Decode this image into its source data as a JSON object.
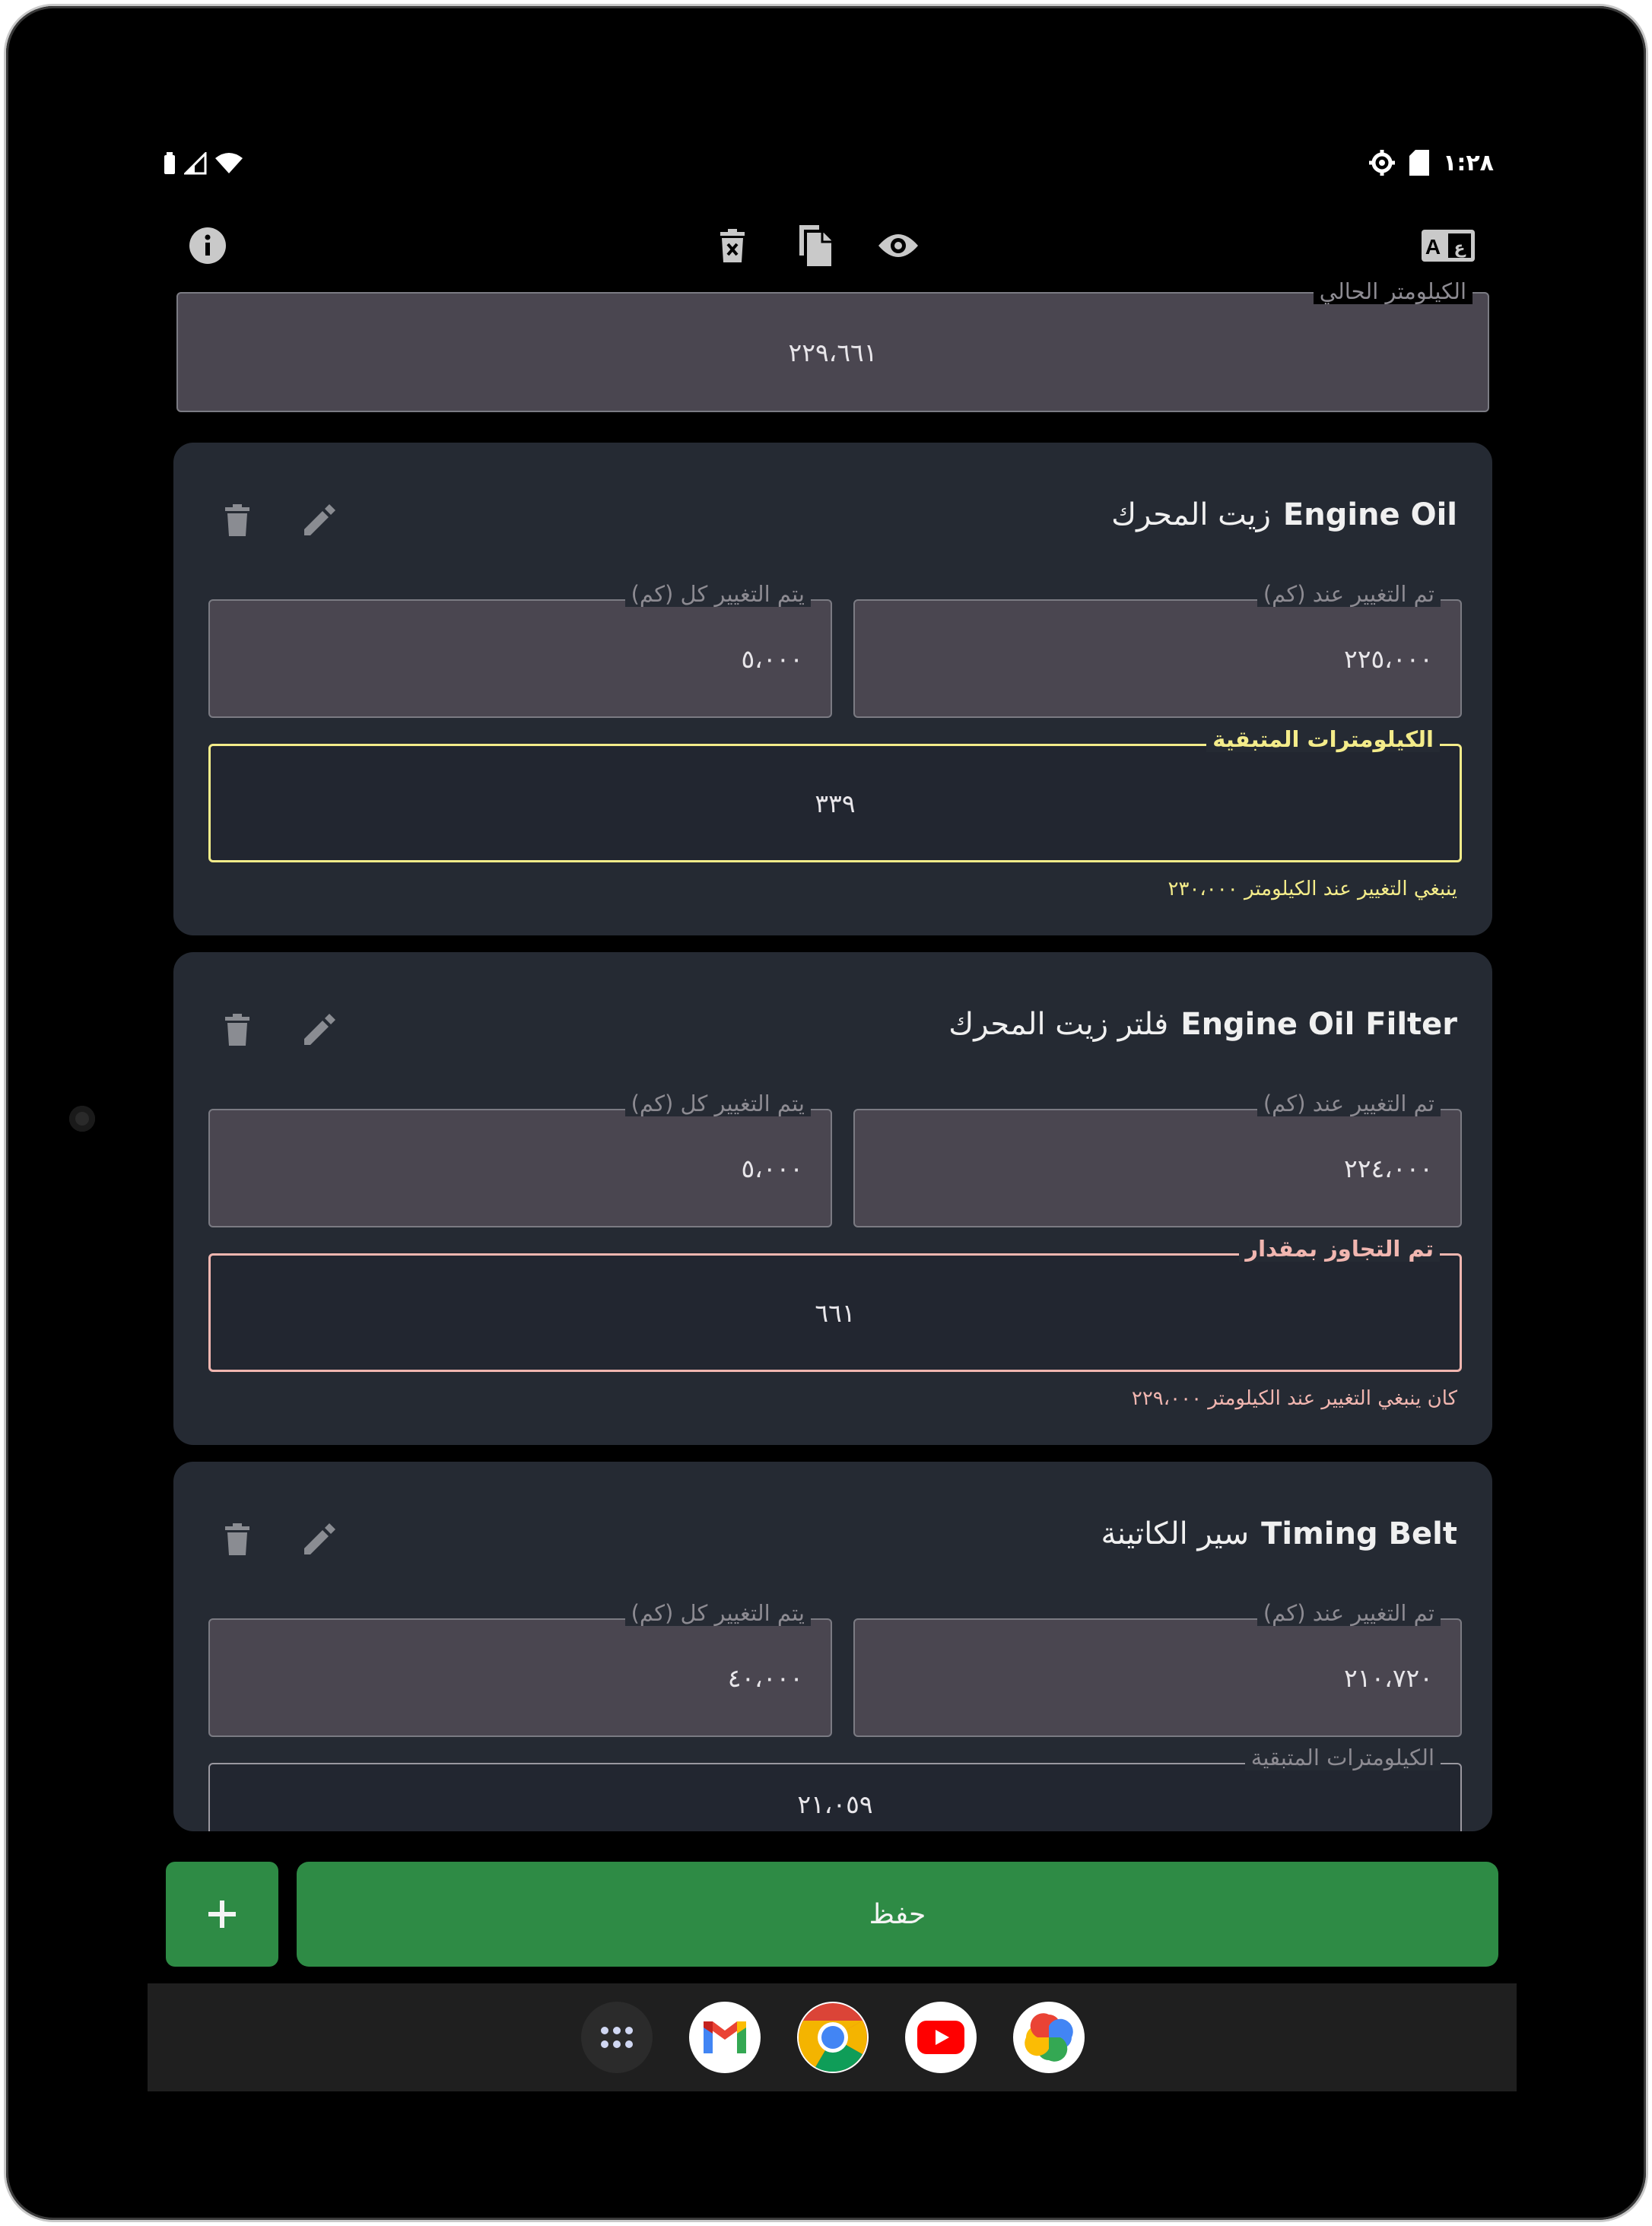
{
  "status_bar": {
    "time": "١:٢٨",
    "icons": [
      "settings-gear-icon",
      "sd-card-icon",
      "wifi-icon",
      "signal-icon",
      "battery-icon"
    ]
  },
  "toolbar": {
    "icons": [
      "info-icon",
      "delete-all-icon",
      "copy-icon",
      "visibility-icon",
      "translate-icon"
    ]
  },
  "current_km": {
    "label": "الكيلومتر الحالي",
    "value": "٢٢٩،٦٦١"
  },
  "cards": [
    {
      "title_en": "Engine Oil",
      "title_ar": "زيت المحرك",
      "changed_at_label": "تم التغيير عند (كم)",
      "changed_at_value": "٢٢٥،٠٠٠",
      "interval_label": "يتم التغيير كل (كم)",
      "interval_value": "٥،٠٠٠",
      "status_label": "الكيلومترات المتبقية",
      "status_value": "٣٣٩",
      "status_color": "#f4ec8a",
      "helper": "ينبغي التغيير عند الكيلومتر ٢٣٠،٠٠٠"
    },
    {
      "title_en": "Engine Oil Filter",
      "title_ar": "فلتر زيت المحرك",
      "changed_at_label": "تم التغيير عند (كم)",
      "changed_at_value": "٢٢٤،٠٠٠",
      "interval_label": "يتم التغيير كل (كم)",
      "interval_value": "٥،٠٠٠",
      "status_label": "تم التجاوز بمقدار",
      "status_value": "٦٦١",
      "status_color": "#f1b6b0",
      "helper": "كان ينبغي التغيير عند الكيلومتر ٢٢٩،٠٠٠"
    },
    {
      "title_en": "Timing Belt",
      "title_ar": "سير الكاتينة",
      "changed_at_label": "تم التغيير عند (كم)",
      "changed_at_value": "٢١٠،٧٢٠",
      "interval_label": "يتم التغيير كل (كم)",
      "interval_value": "٤٠،٠٠٠",
      "status_label": "الكيلومترات المتبقية",
      "status_value": "٢١،٠٥٩",
      "status_color": "#9a98a0",
      "helper": ""
    }
  ],
  "actions": {
    "add_icon": "plus-icon",
    "save_label": "حفظ"
  },
  "dock": {
    "apps": [
      "app-drawer-icon",
      "gmail-icon",
      "chrome-icon",
      "youtube-icon",
      "photos-icon"
    ]
  },
  "colors": {
    "background": "#000000",
    "card": "#252a33",
    "field_fill": "#4a4650",
    "accent_green": "#2e8b45",
    "warning_yellow": "#f4ec8a",
    "error_pink": "#f1b6b0"
  }
}
